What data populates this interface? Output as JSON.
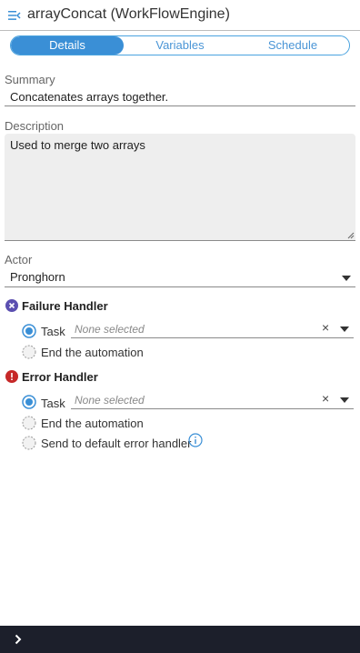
{
  "header": {
    "title": "arrayConcat (WorkFlowEngine)",
    "menu_icon": "menu-collapse-icon"
  },
  "tabs": [
    {
      "label": "Details",
      "active": true
    },
    {
      "label": "Variables",
      "active": false
    },
    {
      "label": "Schedule",
      "active": false
    }
  ],
  "summary": {
    "label": "Summary",
    "value": "Concatenates arrays together."
  },
  "description": {
    "label": "Description",
    "value": "Used to merge two arrays"
  },
  "actor": {
    "label": "Actor",
    "value": "Pronghorn"
  },
  "failure_handler": {
    "title": "Failure Handler",
    "icon": "x-circle-icon",
    "icon_color": "#5b4fb0",
    "task_label": "Task",
    "task_placeholder": "None selected",
    "clear_glyph": "×",
    "end_label": "End the automation",
    "selected": "Task"
  },
  "error_handler": {
    "title": "Error Handler",
    "icon": "alert-circle-icon",
    "icon_color": "#c62828",
    "task_label": "Task",
    "task_placeholder": "None selected",
    "clear_glyph": "×",
    "end_label": "End the automation",
    "default_label": "Send to default error handler",
    "selected": "Task"
  },
  "colors": {
    "accent": "#3a8fd6",
    "footer_bg": "#1c1f2b"
  }
}
